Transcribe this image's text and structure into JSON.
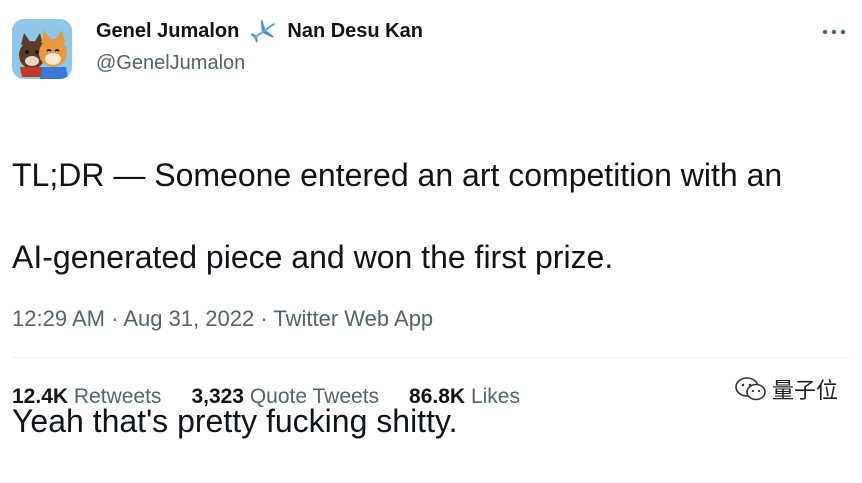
{
  "author": {
    "display_name": "Genel Jumalon",
    "display_name_suffix": "Nan Desu Kan",
    "handle": "@GenelJumalon",
    "avatar_icon": "shiba-dog-avatar-icon",
    "emoji_icon": "airplane-icon"
  },
  "tweet": {
    "line1": "TL;DR — Someone entered an art competition with an",
    "line2": "AI-generated piece and won the first prize.",
    "line3": "Yeah that's pretty fucking shitty."
  },
  "meta": {
    "time": "12:29 AM",
    "date": "Aug 31, 2022",
    "source": "Twitter Web App",
    "separator": "·"
  },
  "stats": {
    "retweets_count": "12.4K",
    "retweets_label": "Retweets",
    "quotes_count": "3,323",
    "quotes_label": "Quote Tweets",
    "likes_count": "86.8K",
    "likes_label": "Likes"
  },
  "watermark": {
    "text": "量子位",
    "icon": "wechat-icon"
  },
  "colors": {
    "text_primary": "#0f1419",
    "text_secondary": "#536471",
    "divider": "#eff3f4",
    "plane": "#5ba4e6"
  }
}
